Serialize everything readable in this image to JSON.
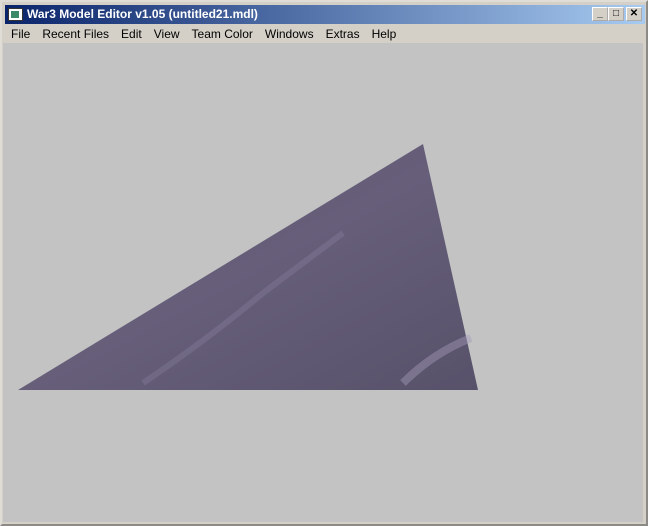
{
  "window": {
    "title": "War3 Model Editor v1.05 (untitled21.mdl)",
    "icon": "app-icon"
  },
  "controls": {
    "minimize": "_",
    "maximize": "□",
    "close": "✕"
  },
  "menu": [
    "File",
    "Recent Files",
    "Edit",
    "View",
    "Team Color",
    "Windows",
    "Extras",
    "Help"
  ],
  "colors": {
    "viewport": "#c3c3c3",
    "triangle": "#5c566e"
  }
}
